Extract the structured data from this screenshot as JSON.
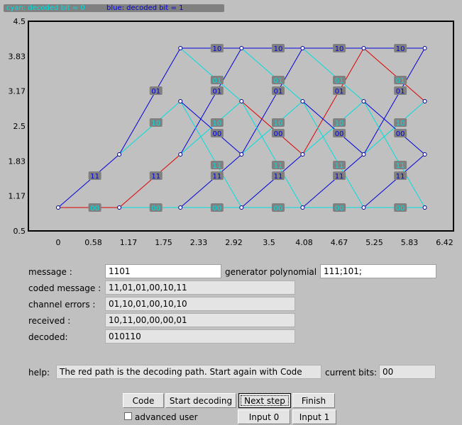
{
  "legend": {
    "cyan_text": "cyan: decoded bit = 0",
    "blue_text": "blue: decoded bit = 1",
    "cyan_color": "#00e0e0",
    "blue_color": "#0000e0"
  },
  "chart_data": {
    "type": "trellis",
    "xlim": [
      0,
      6.42
    ],
    "ylim": [
      0.5,
      4.5
    ],
    "x_ticks": [
      "0",
      "0.58",
      "1.17",
      "1.75",
      "2.33",
      "2.92",
      "3.5",
      "4.08",
      "4.67",
      "5.25",
      "5.83",
      "6.42"
    ],
    "y_ticks": [
      "4.5",
      "3.83",
      "3.17",
      "2.5",
      "1.83",
      "1.17",
      "0.5"
    ],
    "grid": false,
    "colors": {
      "bit0": "#00dede",
      "bit1": "#0000dd",
      "path": "#e00000",
      "label_bg": "#808080"
    },
    "states": [
      1,
      2,
      3,
      4
    ],
    "nodes": [
      {
        "x": 0,
        "y": 1
      },
      {
        "x": 1,
        "y": 1
      },
      {
        "x": 1,
        "y": 2
      },
      {
        "x": 2,
        "y": 1
      },
      {
        "x": 2,
        "y": 2
      },
      {
        "x": 2,
        "y": 3
      },
      {
        "x": 2,
        "y": 4
      },
      {
        "x": 3,
        "y": 1
      },
      {
        "x": 3,
        "y": 2
      },
      {
        "x": 3,
        "y": 3
      },
      {
        "x": 3,
        "y": 4
      },
      {
        "x": 4,
        "y": 1
      },
      {
        "x": 4,
        "y": 2
      },
      {
        "x": 4,
        "y": 3
      },
      {
        "x": 4,
        "y": 4
      },
      {
        "x": 5,
        "y": 1
      },
      {
        "x": 5,
        "y": 2
      },
      {
        "x": 5,
        "y": 3
      },
      {
        "x": 5,
        "y": 4
      },
      {
        "x": 6,
        "y": 1
      },
      {
        "x": 6,
        "y": 2
      },
      {
        "x": 6,
        "y": 3
      },
      {
        "x": 6,
        "y": 4
      }
    ],
    "branches": [
      {
        "from": [
          0,
          1
        ],
        "to": [
          1,
          1
        ],
        "bit": 0,
        "label": "00",
        "path": true
      },
      {
        "from": [
          0,
          1
        ],
        "to": [
          1,
          2
        ],
        "bit": 1,
        "label": "11"
      },
      {
        "from": [
          1,
          1
        ],
        "to": [
          2,
          1
        ],
        "bit": 0,
        "label": "00"
      },
      {
        "from": [
          1,
          1
        ],
        "to": [
          2,
          2
        ],
        "bit": 1,
        "label": "11",
        "path": true
      },
      {
        "from": [
          1,
          2
        ],
        "to": [
          2,
          3
        ],
        "bit": 0,
        "label": "10"
      },
      {
        "from": [
          1,
          2
        ],
        "to": [
          2,
          4
        ],
        "bit": 1,
        "label": "01"
      },
      {
        "from": [
          2,
          1
        ],
        "to": [
          3,
          1
        ],
        "bit": 0,
        "label": "00"
      },
      {
        "from": [
          2,
          1
        ],
        "to": [
          3,
          2
        ],
        "bit": 1,
        "label": "11"
      },
      {
        "from": [
          2,
          2
        ],
        "to": [
          3,
          3
        ],
        "bit": 0,
        "label": "10"
      },
      {
        "from": [
          2,
          2
        ],
        "to": [
          3,
          4
        ],
        "bit": 1,
        "label": "01"
      },
      {
        "from": [
          2,
          3
        ],
        "to": [
          3,
          1
        ],
        "bit": 0,
        "label": "11"
      },
      {
        "from": [
          2,
          3
        ],
        "to": [
          3,
          2
        ],
        "bit": 1,
        "label": "00"
      },
      {
        "from": [
          2,
          4
        ],
        "to": [
          3,
          3
        ],
        "bit": 0,
        "label": "01"
      },
      {
        "from": [
          2,
          4
        ],
        "to": [
          3,
          4
        ],
        "bit": 1,
        "label": "10"
      },
      {
        "from": [
          3,
          1
        ],
        "to": [
          4,
          1
        ],
        "bit": 0,
        "label": "00"
      },
      {
        "from": [
          3,
          1
        ],
        "to": [
          4,
          2
        ],
        "bit": 1,
        "label": "11"
      },
      {
        "from": [
          3,
          2
        ],
        "to": [
          4,
          3
        ],
        "bit": 0,
        "label": "10"
      },
      {
        "from": [
          3,
          2
        ],
        "to": [
          4,
          4
        ],
        "bit": 1,
        "label": "01"
      },
      {
        "from": [
          3,
          3
        ],
        "to": [
          4,
          1
        ],
        "bit": 0,
        "label": "11"
      },
      {
        "from": [
          3,
          3
        ],
        "to": [
          4,
          2
        ],
        "bit": 1,
        "label": "00",
        "path": true
      },
      {
        "from": [
          3,
          4
        ],
        "to": [
          4,
          3
        ],
        "bit": 0,
        "label": "01"
      },
      {
        "from": [
          3,
          4
        ],
        "to": [
          4,
          4
        ],
        "bit": 1,
        "label": "10"
      },
      {
        "from": [
          4,
          1
        ],
        "to": [
          5,
          1
        ],
        "bit": 0,
        "label": "00"
      },
      {
        "from": [
          4,
          1
        ],
        "to": [
          5,
          2
        ],
        "bit": 1,
        "label": "11"
      },
      {
        "from": [
          4,
          2
        ],
        "to": [
          5,
          3
        ],
        "bit": 0,
        "label": "10"
      },
      {
        "from": [
          4,
          2
        ],
        "to": [
          5,
          4
        ],
        "bit": 1,
        "label": "01",
        "path": true
      },
      {
        "from": [
          4,
          3
        ],
        "to": [
          5,
          1
        ],
        "bit": 0,
        "label": "11"
      },
      {
        "from": [
          4,
          3
        ],
        "to": [
          5,
          2
        ],
        "bit": 1,
        "label": "00"
      },
      {
        "from": [
          4,
          4
        ],
        "to": [
          5,
          3
        ],
        "bit": 0,
        "label": "01"
      },
      {
        "from": [
          4,
          4
        ],
        "to": [
          5,
          4
        ],
        "bit": 1,
        "label": "10"
      },
      {
        "from": [
          5,
          1
        ],
        "to": [
          6,
          1
        ],
        "bit": 0,
        "label": "00"
      },
      {
        "from": [
          5,
          1
        ],
        "to": [
          6,
          2
        ],
        "bit": 1,
        "label": "11"
      },
      {
        "from": [
          5,
          2
        ],
        "to": [
          6,
          3
        ],
        "bit": 0,
        "label": "10"
      },
      {
        "from": [
          5,
          2
        ],
        "to": [
          6,
          4
        ],
        "bit": 1,
        "label": "01"
      },
      {
        "from": [
          5,
          3
        ],
        "to": [
          6,
          1
        ],
        "bit": 0,
        "label": "11"
      },
      {
        "from": [
          5,
          3
        ],
        "to": [
          6,
          2
        ],
        "bit": 1,
        "label": "00"
      },
      {
        "from": [
          5,
          4
        ],
        "to": [
          6,
          3
        ],
        "bit": 0,
        "label": "01",
        "path": true
      },
      {
        "from": [
          5,
          4
        ],
        "to": [
          6,
          4
        ],
        "bit": 1,
        "label": "10"
      }
    ]
  },
  "form": {
    "message_label": "message :",
    "message_value": "1101",
    "generator_label": "generator polynomial :",
    "generator_value": "111;101;",
    "coded_label": "coded message :",
    "coded_value": "11,01,01,00,10,11",
    "errors_label": "channel errors :",
    "errors_value": "01,10,01,00,10,10",
    "received_label": "received :",
    "received_value": "10,11,00,00,00,01",
    "decoded_label": "decoded:",
    "decoded_value": "010110",
    "help_label": "help:",
    "help_value": "The red path is the decoding path. Start again with Code",
    "current_bits_label": "current bits:",
    "current_bits_value": "00"
  },
  "buttons": {
    "code": "Code",
    "start_decoding": "Start decoding",
    "next_step": "Next step",
    "finish": "Finish",
    "input0": "Input 0",
    "input1": "Input 1"
  },
  "advanced": {
    "label": "advanced user",
    "checked": false
  }
}
